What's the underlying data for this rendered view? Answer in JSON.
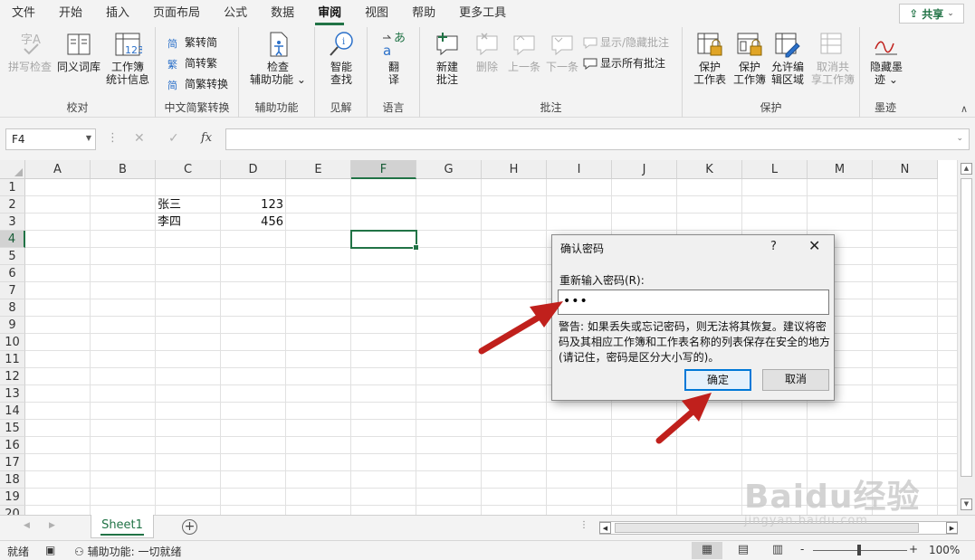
{
  "menu": {
    "tabs": [
      "文件",
      "开始",
      "插入",
      "页面布局",
      "公式",
      "数据",
      "审阅",
      "视图",
      "帮助",
      "更多工具"
    ],
    "active": "审阅",
    "share_label": "共享"
  },
  "ribbon": {
    "proofing": {
      "spell": "拼写检查",
      "thesaurus": "同义词库",
      "stats_l1": "工作簿",
      "stats_l2": "统计信息",
      "label": "校对"
    },
    "chinese": {
      "to_trad": "繁转简",
      "to_simp": "简转繁",
      "convert": "简繁转换",
      "label": "中文简繁转换"
    },
    "access": {
      "check_l1": "检查",
      "check_l2": "辅助功能",
      "label": "辅助功能"
    },
    "insights": {
      "smart_l1": "智能",
      "smart_l2": "查找",
      "label": "见解"
    },
    "language": {
      "translate_l1": "翻",
      "translate_l2": "译",
      "label": "语言"
    },
    "comments": {
      "new_l1": "新建",
      "new_l2": "批注",
      "delete": "删除",
      "prev": "上一条",
      "next": "下一条",
      "show_hide": "显示/隐藏批注",
      "show_all": "显示所有批注",
      "label": "批注"
    },
    "protect": {
      "sheet_l1": "保护",
      "sheet_l2": "工作表",
      "book_l1": "保护",
      "book_l2": "工作簿",
      "ranges_l1": "允许编",
      "ranges_l2": "辑区域",
      "unshare_l1": "取消共",
      "unshare_l2": "享工作簿",
      "label": "保护"
    },
    "ink": {
      "hide_l1": "隐藏墨",
      "hide_l2": "迹",
      "label": "墨迹"
    }
  },
  "formula_bar": {
    "name_box": "F4",
    "fx": "fx",
    "value": ""
  },
  "grid": {
    "columns": [
      "A",
      "B",
      "C",
      "D",
      "E",
      "F",
      "G",
      "H",
      "I",
      "J",
      "K",
      "L",
      "M",
      "N"
    ],
    "rows": [
      "1",
      "2",
      "3",
      "4",
      "5",
      "6",
      "7",
      "8",
      "9",
      "10",
      "11",
      "12",
      "13",
      "14",
      "15",
      "16",
      "17",
      "18",
      "19",
      "20"
    ],
    "selected_col": "F",
    "selected_row": "4",
    "cells": {
      "C2": "张三",
      "D2": "123",
      "C3": "李四",
      "D3": "456"
    }
  },
  "sheets": {
    "tabs": [
      "Sheet1"
    ],
    "active": "Sheet1"
  },
  "status": {
    "ready": "就绪",
    "accessibility": "辅助功能: 一切就绪",
    "zoom": "100%",
    "minus": "-",
    "plus": "+"
  },
  "dialog": {
    "title": "确认密码",
    "help": "?",
    "prompt": "重新输入密码(R):",
    "password_masked": "•••",
    "warning": "警告: 如果丢失或忘记密码，则无法将其恢复。建议将密码及其相应工作簿和工作表名称的列表保存在安全的地方(请记住，密码是区分大小写的)。",
    "ok": "确定",
    "cancel": "取消"
  },
  "watermark": {
    "brand": "Baidu经验",
    "url": "jingyan.baidu.com"
  },
  "colors": {
    "excel_green": "#217346",
    "arrow_red": "#c0201c",
    "dialog_focus": "#0078d7"
  }
}
